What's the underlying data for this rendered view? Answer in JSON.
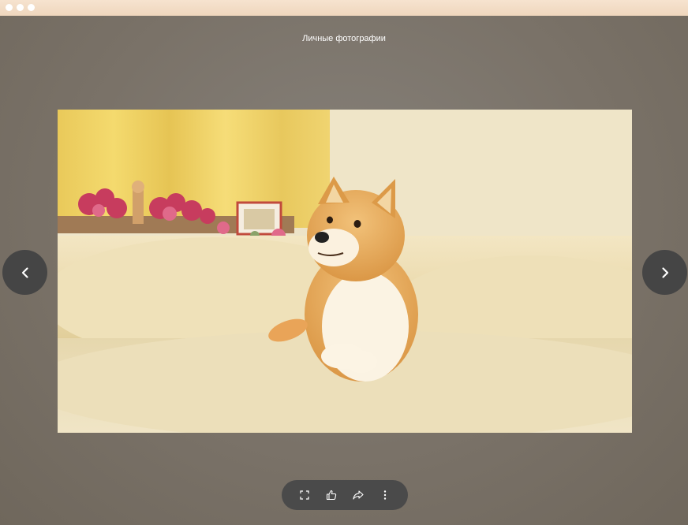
{
  "viewer": {
    "title": "Личные фотографии"
  },
  "photo": {
    "subject": "shiba-inu-dog"
  },
  "navigation": {
    "prev_icon": "chevron-left-icon",
    "next_icon": "chevron-right-icon"
  },
  "toolbar": {
    "items": [
      {
        "icon": "fullscreen-icon"
      },
      {
        "icon": "thumbs-up-icon"
      },
      {
        "icon": "share-icon"
      },
      {
        "icon": "more-vertical-icon"
      }
    ]
  },
  "colors": {
    "titlebar": "#f2dcc6",
    "backdrop": "#7d766d",
    "control_bg": "#454545",
    "icon": "#ffffff"
  }
}
